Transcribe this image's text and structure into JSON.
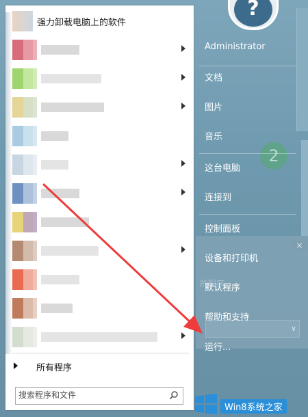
{
  "start_menu": {
    "programs": [
      {
        "label": "强力卸载电脑上的软件",
        "has_submenu": false
      },
      {
        "label": "",
        "has_submenu": true
      },
      {
        "label": "",
        "has_submenu": true
      },
      {
        "label": "",
        "has_submenu": true
      },
      {
        "label": "",
        "has_submenu": false
      },
      {
        "label": "",
        "has_submenu": true
      },
      {
        "label": "",
        "has_submenu": true
      },
      {
        "label": "",
        "has_submenu": false
      },
      {
        "label": "",
        "has_submenu": true
      },
      {
        "label": "",
        "has_submenu": false
      },
      {
        "label": "",
        "has_submenu": false
      },
      {
        "label": "",
        "has_submenu": true
      }
    ],
    "all_programs_label": "所有程序",
    "search_placeholder": "搜索程序和文件"
  },
  "right_pane": {
    "user_name": "Administrator",
    "items": [
      "文档",
      "图片",
      "音乐",
      "这台电脑",
      "连接到",
      "控制面板",
      "设备和打印机",
      "默认程序",
      "帮助和支持",
      "运行..."
    ]
  },
  "desktop": {
    "dialog_close": "×",
    "dialog_text": "的程序、",
    "badge": "2"
  },
  "watermark": {
    "text": "Win8系统之家"
  },
  "colors": {
    "desktop_bg": "#6e99ae",
    "menu_bg": "#ffffff",
    "annotation_arrow": "#ee3b3b",
    "watermark_bg": "#2a8fd8"
  }
}
